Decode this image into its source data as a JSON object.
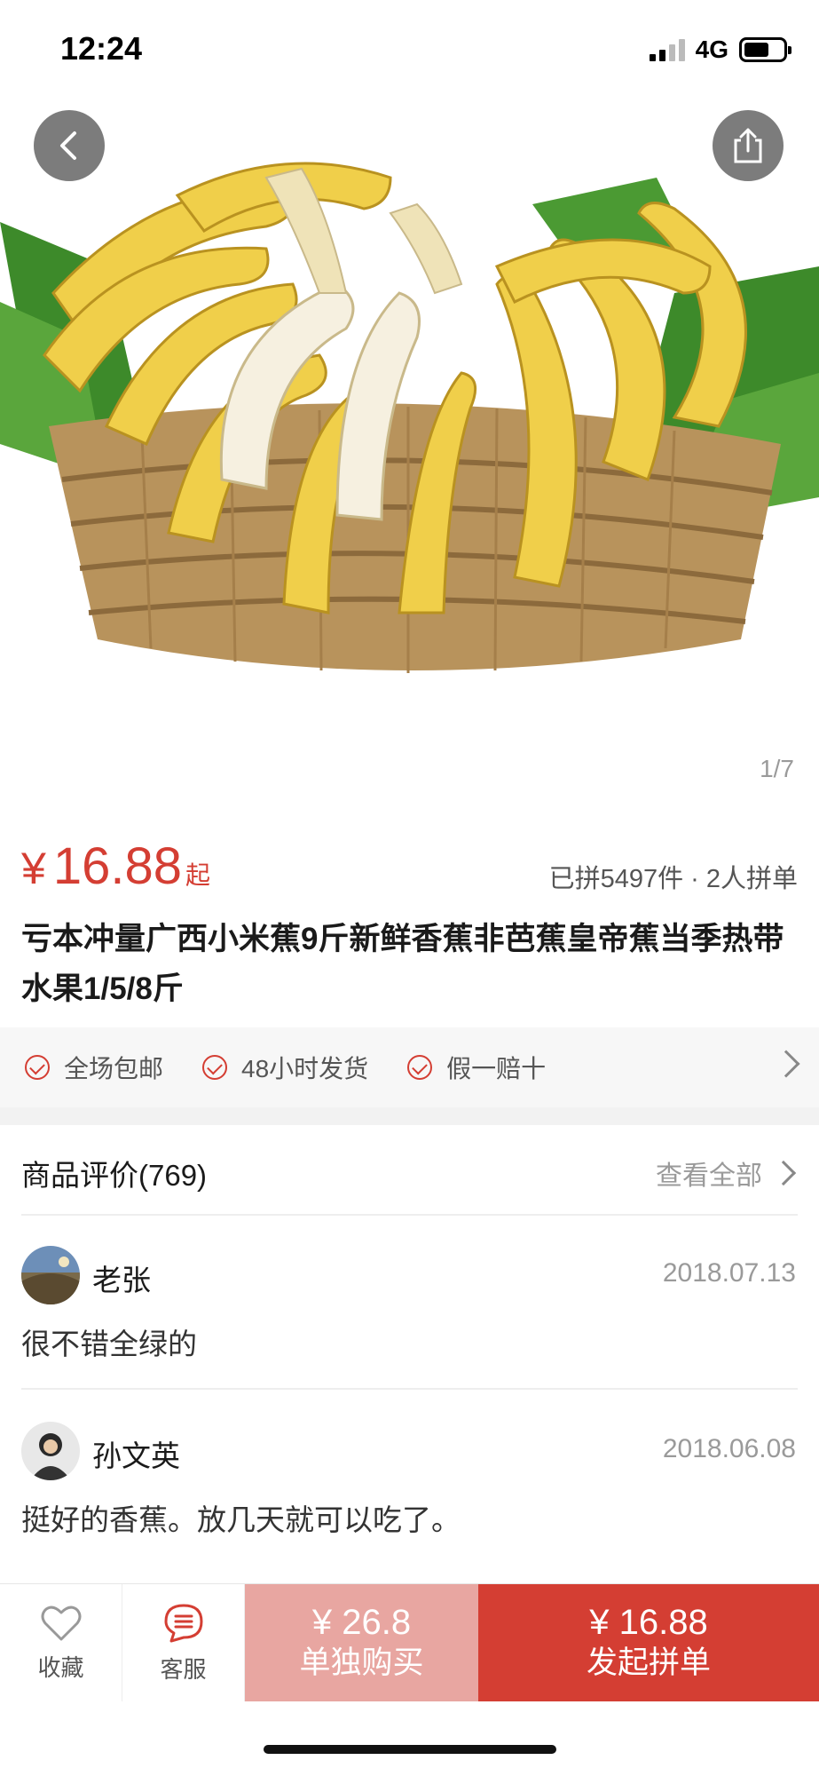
{
  "status_bar": {
    "time": "12:24",
    "network": "4G",
    "battery_level": 0.65
  },
  "gallery": {
    "back_icon": "chevron-left-icon",
    "share_icon": "share-icon",
    "counter": "1/7"
  },
  "product": {
    "currency": "¥",
    "price": "16.88",
    "price_suffix": "起",
    "sold_info": "已拼5497件 · 2人拼单",
    "title": "亏本冲量广西小米蕉9斤新鲜香蕉非芭蕉皇帝蕉当季热带水果1/5/8斤"
  },
  "services": [
    {
      "label": "全场包邮"
    },
    {
      "label": "48小时发货"
    },
    {
      "label": "假一赔十"
    }
  ],
  "reviews": {
    "title": "商品评价(769)",
    "view_all": "查看全部",
    "items": [
      {
        "name": "老张",
        "date": "2018.07.13",
        "text": "很不错全绿的"
      },
      {
        "name": "孙文英",
        "date": "2018.06.08",
        "text": "挺好的香蕉。放几天就可以吃了。"
      }
    ]
  },
  "bottom_bar": {
    "favorite_label": "收藏",
    "service_label": "客服",
    "solo_price": "¥ 26.8",
    "solo_label": "单独购买",
    "group_price": "¥ 16.88",
    "group_label": "发起拼单"
  },
  "colors": {
    "accent": "#d43e33",
    "accent_light": "#e8a6a1"
  }
}
